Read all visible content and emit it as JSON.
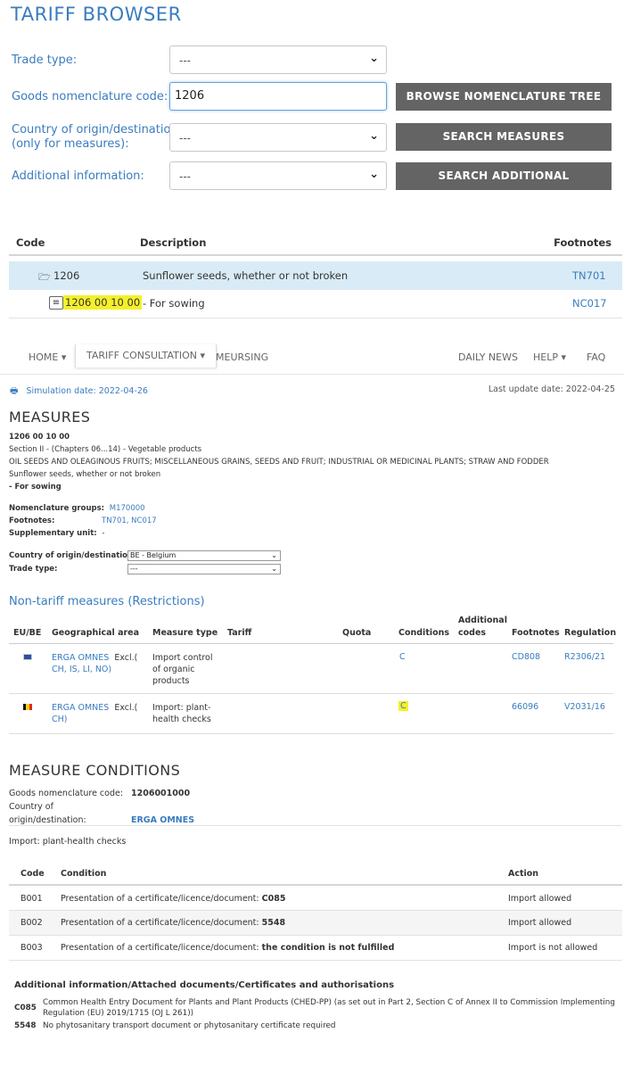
{
  "browser": {
    "title": "TARIFF BROWSER",
    "trade_type_label": "Trade type:",
    "trade_type_value": "---",
    "goods_code_label": "Goods nomenclature code:",
    "goods_code_value": "1206",
    "country_label_line1": "Country of origin/destination",
    "country_label_line2": "(only for measures):",
    "country_value": "---",
    "additional_info_label": "Additional information:",
    "additional_info_value": "---",
    "btn_browse": "BROWSE NOMENCLATURE TREE",
    "btn_search_measures": "SEARCH MEASURES",
    "btn_search_additional": "SEARCH ADDITIONAL INFORMATION"
  },
  "tree": {
    "headers": {
      "code": "Code",
      "description": "Description",
      "footnotes": "Footnotes"
    },
    "rows": [
      {
        "code": "1206",
        "description": "Sunflower seeds, whether or not broken",
        "footnote": "TN701"
      },
      {
        "code": "1206 00 10 00",
        "description": "- For sowing",
        "footnote": "NC017"
      }
    ]
  },
  "nav": {
    "home": "HOME",
    "tariff": "TARIFF CONSULTATION",
    "meursing": "MEURSING",
    "daily_news": "DAILY NEWS",
    "help": "HELP",
    "faq": "FAQ"
  },
  "info": {
    "sim_label": "Simulation date:",
    "sim_date": "2022-04-26",
    "last_update": "Last update date: 2022-04-25"
  },
  "measures": {
    "title": "MEASURES",
    "code": "1206 00 10 00",
    "section": "Section II - (Chapters 06...14) - Vegetable products",
    "chapter": "OIL SEEDS AND OLEAGINOUS FRUITS; MISCELLANEOUS GRAINS, SEEDS AND FRUIT; INDUSTRIAL OR MEDICINAL PLANTS; STRAW AND FODDER",
    "heading": "Sunflower seeds, whether or not broken",
    "subheading": "- For sowing",
    "nomenclature_groups_label": "Nomenclature groups:",
    "nomenclature_groups_value": "M170000",
    "footnotes_label": "Footnotes:",
    "footnotes_value": "TN701, NC017",
    "supplementary_label": "Supplementary unit:",
    "supplementary_value": "-",
    "country_label": "Country of origin/destination:",
    "country_value": "BE - Belgium",
    "trade_type_label": "Trade type:",
    "trade_type_value": "---"
  },
  "ntm": {
    "title": "Non-tariff measures (Restrictions)",
    "headers": {
      "eube": "EU/BE",
      "geo": "Geographical area",
      "type": "Measure type",
      "tariff": "Tariff",
      "quota": "Quota",
      "conditions": "Conditions",
      "additional_1": "Additional",
      "additional_2": "codes",
      "footnotes": "Footnotes",
      "regulation": "Regulation"
    },
    "rows": [
      {
        "flag": "eu-flag-icon",
        "geo_1": "ERGA OMNES",
        "excl": "Excl.(",
        "geo_2": "CH, IS, LI, NO)",
        "type_1": "Import control",
        "type_2": "of organic",
        "type_3": "products",
        "condition": "C",
        "footnote": "CD808",
        "regulation": "R2306/21"
      },
      {
        "flag": "belgium-flag-icon",
        "geo_1": "ERGA OMNES",
        "excl": "Excl.(",
        "geo_2": "CH)",
        "type_1": "Import: plant-",
        "type_2": "health checks",
        "condition": "C",
        "footnote": "66096",
        "regulation": "V2031/16"
      }
    ]
  },
  "mc": {
    "title": "MEASURE CONDITIONS",
    "goods_label": "Goods nomenclature code:",
    "goods_value": "1206001000",
    "country_label": "Country of origin/destination:",
    "country_value": "ERGA OMNES",
    "measure_type": "Import: plant-health checks",
    "headers": {
      "code": "Code",
      "condition": "Condition",
      "action": "Action"
    },
    "rows": [
      {
        "code": "B001",
        "condition": "Presentation of a certificate/licence/document:",
        "doc": "C085",
        "action": "Import allowed"
      },
      {
        "code": "B002",
        "condition": "Presentation of a certificate/licence/document:",
        "doc": "5548",
        "action": "Import allowed"
      },
      {
        "code": "B003",
        "condition": "Presentation of a certificate/licence/document:",
        "doc": "the condition is not fulfilled",
        "action": "Import is not allowed"
      }
    ],
    "additional_title": "Additional information/Attached documents/Certificates and authorisations",
    "docs": [
      {
        "code": "C085",
        "line1": "Common Health Entry Document for Plants and Plant Products (CHED-PP) (as set out in Part 2, Section C of Annex II to Commission Implementing",
        "line2": "Regulation (EU) 2019/1715 (OJ L 261))"
      },
      {
        "code": "5548",
        "line1": "No phytosanitary transport document or phytosanitary certificate required"
      }
    ]
  }
}
